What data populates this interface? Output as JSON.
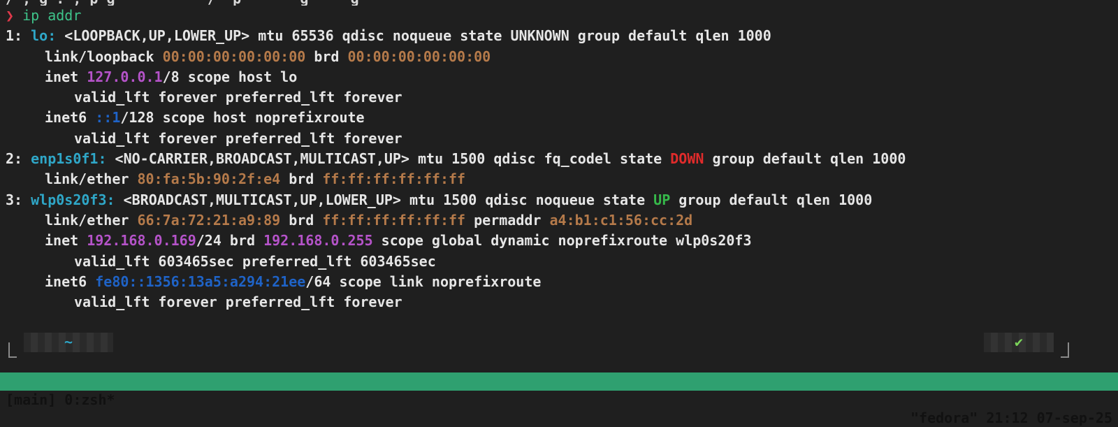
{
  "top_fragment": "/ , g : , p g           /  p       g     g",
  "prompt": {
    "arrow": "❯",
    "command": "ip addr"
  },
  "interfaces": {
    "lo": {
      "header_num": "1: ",
      "name": "lo:",
      "flags": " <LOOPBACK,UP,LOWER_UP> mtu 65536 qdisc noqueue state UNKNOWN group default qlen 1000",
      "link_prefix": "link/loopback ",
      "mac": "00:00:00:00:00:00",
      "brd_label": " brd ",
      "brd": "00:00:00:00:00:00",
      "inet_label": "inet ",
      "inet": "127.0.0.1",
      "inet_suffix": "/8 scope host lo",
      "valid1": "valid_lft forever preferred_lft forever",
      "inet6_label": "inet6 ",
      "inet6": "::1",
      "inet6_suffix": "/128 scope host noprefixroute",
      "valid2": "valid_lft forever preferred_lft forever"
    },
    "enp": {
      "header_num": "2: ",
      "name": "enp1s0f1:",
      "flags": " <NO-CARRIER,BROADCAST,MULTICAST,UP> mtu 1500 qdisc fq_codel state ",
      "state": "DOWN",
      "flags_tail": " group default qlen 1000",
      "link_prefix": "link/ether ",
      "mac": "80:fa:5b:90:2f:e4",
      "brd_label": " brd ",
      "brd": "ff:ff:ff:ff:ff:ff"
    },
    "wlp": {
      "header_num": "3: ",
      "name": "wlp0s20f3:",
      "flags": " <BROADCAST,MULTICAST,UP,LOWER_UP> mtu 1500 qdisc noqueue state ",
      "state": "UP",
      "flags_tail": " group default qlen 1000",
      "link_prefix": "link/ether ",
      "mac": "66:7a:72:21:a9:89",
      "brd_label": " brd ",
      "brd": "ff:ff:ff:ff:ff:ff",
      "perm_label": " permaddr ",
      "permaddr": "a4:b1:c1:56:cc:2d",
      "inet_label": "inet ",
      "inet": "192.168.0.169",
      "inet_mid": "/24 brd ",
      "inet_brd": "192.168.0.255",
      "inet_suffix": " scope global dynamic noprefixroute wlp0s20f3",
      "valid1": "valid_lft 603465sec preferred_lft 603465sec",
      "inet6_label": "inet6 ",
      "inet6": "fe80::1356:13a5:a294:21ee",
      "inet6_suffix": "/64 scope link noprefixroute",
      "valid2": "valid_lft forever preferred_lft forever"
    }
  },
  "rprompt": {
    "left_segment": "~",
    "right_segment": "✔"
  },
  "tmux": {
    "left": "[main] 0:zsh*",
    "right": "\"fedora\" 21:12 07-sep-25"
  },
  "colors": {
    "background": "#1f1f1f",
    "prompt_arrow": "#e0394b",
    "command": "#3ec38a",
    "interface": "#2fa7c8",
    "mac": "#b57a4a",
    "ipv4": "#b553c9",
    "ipv6": "#1f63c7",
    "state_down": "#e02b2b",
    "state_up": "#36b94a",
    "tmux_bar": "#2fa070"
  }
}
